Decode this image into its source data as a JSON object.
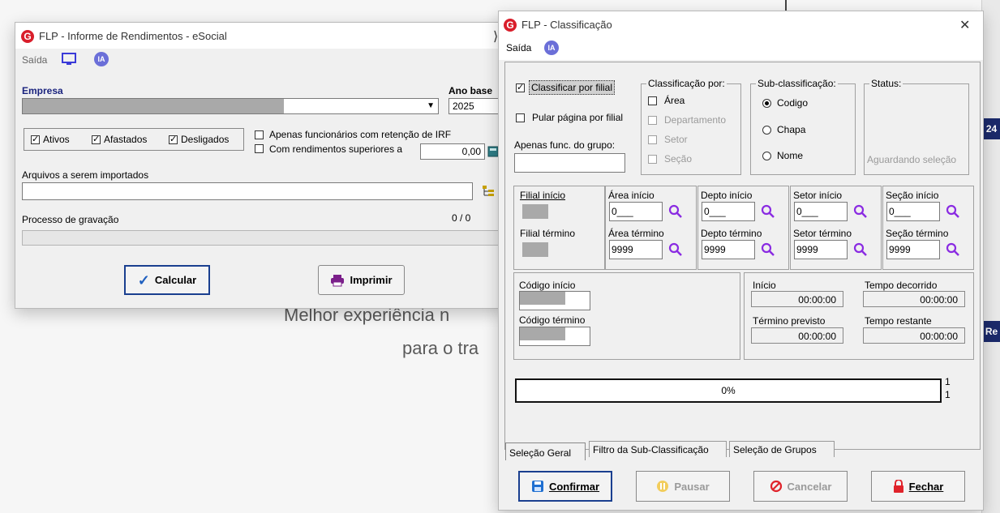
{
  "background": {
    "badge_top": "24",
    "badge_bottom": "Re",
    "text_line1": "Melhor experiência n",
    "text_line2": "para o tra"
  },
  "win1": {
    "title": "FLP - Informe de Rendimentos -  eSocial",
    "logo": "G",
    "menu_saida": "Saída",
    "ia_label": "IA",
    "empresa_label": "Empresa",
    "ano_base_label": "Ano base",
    "ano_base_value": "2025",
    "ativos": "Ativos",
    "afastados": "Afastados",
    "desligados": "Desligados",
    "apenas_irf": "Apenas funcionários com retenção de IRF",
    "com_rendimentos": "Com rendimentos superiores a",
    "rendimento_value": "0,00",
    "arquivos_label": "Arquivos a serem importados",
    "processo_label": "Processo de gravação",
    "processo_count": "0 / 0",
    "calcular": "Calcular",
    "imprimir": "Imprimir"
  },
  "win2": {
    "title": "FLP - Classificação",
    "logo": "G",
    "close": "✕",
    "menu_saida": "Saída",
    "ia_label": "IA",
    "classificar_por_filial": "Classificar por filial",
    "pular_pagina": "Pular página por filial",
    "apenas_grupo": "Apenas func. do grupo:",
    "classificacao_por": "Classificação  por:",
    "area": "Área",
    "departamento": "Departamento",
    "setor": "Setor",
    "secao": "Seção",
    "sub_classificacao": "Sub-classificação:",
    "codigo": "Codigo",
    "chapa": "Chapa",
    "nome": "Nome",
    "status": "Status:",
    "aguardando": "Aguardando seleção",
    "filial_inicio": "Filial início",
    "filial_termino": "Filial término",
    "area_inicio": "Área início",
    "area_termino": "Área término",
    "depto_inicio": "Depto início",
    "depto_termino": "Depto término",
    "setor_inicio": "Setor início",
    "setor_termino": "Setor término",
    "secao_inicio": "Seção início",
    "secao_termino": "Seção término",
    "start_value": "0___",
    "end_value": "9999",
    "codigo_inicio": "Código início",
    "codigo_termino": "Código término",
    "inicio": "Início",
    "tempo_decorrido": "Tempo decorrido",
    "termino_previsto": "Término previsto",
    "tempo_restante": "Tempo restante",
    "time_value": "00:00:00",
    "progress": "0%",
    "progress_right_1": "1",
    "progress_right_2": "1",
    "tabs": [
      "Seleção Geral",
      "Filtro da Sub-Classificação",
      "Seleção de Grupos"
    ],
    "confirmar": "Confirmar",
    "pausar": "Pausar",
    "cancelar": "Cancelar",
    "fechar": "Fechar"
  }
}
